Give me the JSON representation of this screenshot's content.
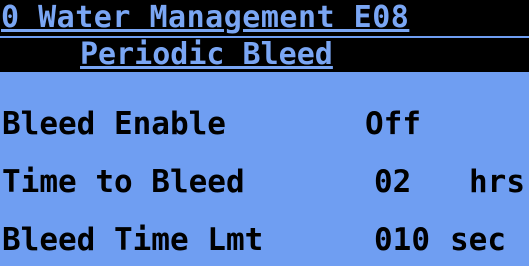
{
  "header": {
    "title": "0 Water Management E08",
    "subtitle": "Periodic Bleed"
  },
  "rows": [
    {
      "label": "Bleed Enable",
      "value": "Off",
      "unit": ""
    },
    {
      "label": "Time to Bleed",
      "value": "02",
      "unit": "hrs"
    },
    {
      "label": "Bleed Time Lmt",
      "value": "010",
      "unit": "sec"
    }
  ],
  "colors": {
    "screen_background": "#6f9ef2",
    "header_background": "#000000",
    "header_text": "#7aa6f4",
    "body_text": "#000000"
  }
}
